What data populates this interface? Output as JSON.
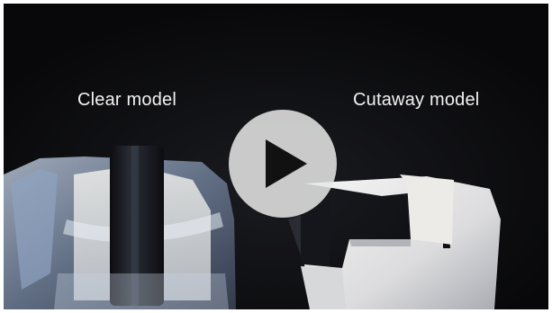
{
  "video": {
    "left_label": "Clear model",
    "right_label": "Cutaway model",
    "play_icon": "play-icon"
  },
  "colors": {
    "background": "#0b0b0d",
    "label_text": "#f2f2f2",
    "play_button": "#e8e8e8",
    "play_icon": "#111111"
  }
}
